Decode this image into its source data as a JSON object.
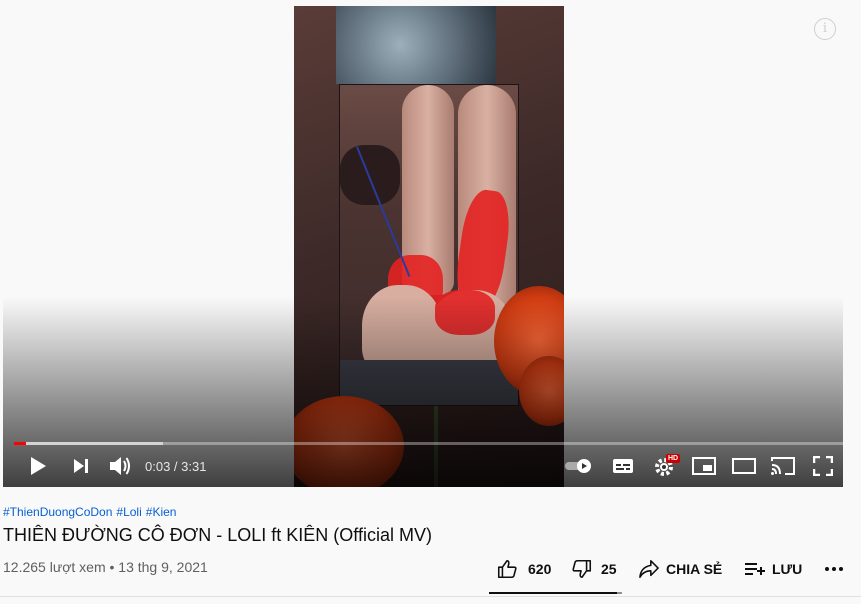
{
  "player": {
    "time_current": "0:03",
    "time_sep": " / ",
    "time_total": "3:31",
    "played_fraction": 0.015,
    "buffered_fraction": 0.18,
    "hd_badge": "HD",
    "info_glyph": "i"
  },
  "video": {
    "hashtags": [
      "#ThienDuongCoDon",
      "#Loli",
      "#Kien"
    ],
    "title": "THIÊN ĐƯỜNG CÔ ĐƠN - LOLI ft KIÊN (Official MV)",
    "views": "12.265 lượt xem",
    "date_sep": " • ",
    "date": "13 thg 9, 2021"
  },
  "actions": {
    "like_count": "620",
    "dislike_count": "25",
    "share_label": "CHIA SẺ",
    "save_label": "LƯU",
    "like_fraction": 0.96
  },
  "colors": {
    "accent": "#ff0000",
    "link": "#065fd4"
  },
  "icons": [
    "info-icon",
    "play-icon",
    "next-icon",
    "volume-icon",
    "autoplay-toggle-icon",
    "subtitles-icon",
    "settings-icon",
    "miniplayer-icon",
    "theater-icon",
    "cast-icon",
    "fullscreen-icon",
    "like-icon",
    "dislike-icon",
    "share-icon",
    "save-icon",
    "more-icon"
  ]
}
